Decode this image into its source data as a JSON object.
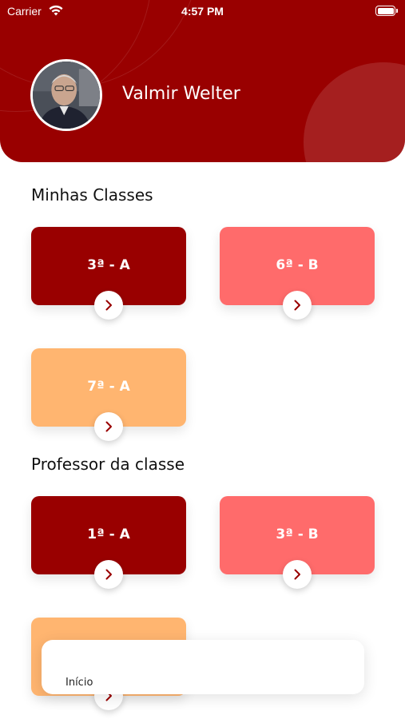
{
  "status_bar": {
    "carrier": "Carrier",
    "time": "4:57 PM"
  },
  "profile": {
    "name": "Valmir Welter"
  },
  "sections": {
    "my_classes": {
      "title": "Minhas Classes",
      "cards": [
        {
          "label": "3ª - A",
          "color": "#990000"
        },
        {
          "label": "6ª - B",
          "color": "#FF6B6B"
        },
        {
          "label": "7ª - A",
          "color": "#FFB570"
        }
      ]
    },
    "class_teacher": {
      "title": "Professor da classe",
      "cards": [
        {
          "label": "1ª - A",
          "color": "#990000"
        },
        {
          "label": "3ª - B",
          "color": "#FF6B6B"
        },
        {
          "label": "",
          "color": "#FFB570"
        }
      ]
    }
  },
  "tabbar": {
    "items": [
      {
        "label": "Início",
        "icon": "home-icon"
      }
    ]
  },
  "colors": {
    "header": "#990000",
    "accent": "#990000"
  }
}
